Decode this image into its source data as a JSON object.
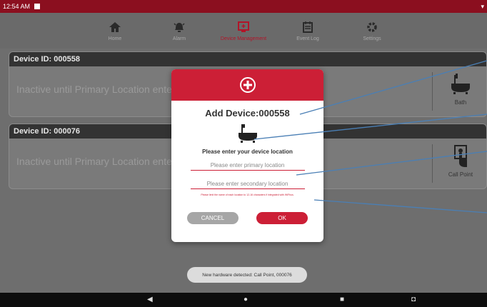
{
  "status_bar": {
    "time": "12:54 AM"
  },
  "nav": {
    "items": [
      {
        "label": "Home",
        "icon": "home-icon"
      },
      {
        "label": "Alarm",
        "icon": "alarm-icon"
      },
      {
        "label": "Device Management",
        "icon": "device-management-icon"
      },
      {
        "label": "Event Log",
        "icon": "event-log-icon"
      },
      {
        "label": "Settings",
        "icon": "settings-icon"
      }
    ],
    "active": "Device Management"
  },
  "devices": [
    {
      "header": "Device ID: 000558",
      "message": "Inactive until Primary Location entered",
      "type_label": "Bath",
      "icon": "bathtub-icon"
    },
    {
      "header": "Device ID: 000076",
      "message": "Inactive until Primary Location entered",
      "type_label": "Call Point",
      "icon": "call-point-icon"
    }
  ],
  "dialog": {
    "title": "Add Device:000558",
    "prompt": "Please enter your device location",
    "primary_placeholder": "Please enter primary location",
    "secondary_placeholder": "Please enter secondary location",
    "note": "Please limit the name of each location to 12-16 characters if integrated with WiFbus.",
    "cancel_label": "CANCEL",
    "ok_label": "OK"
  },
  "toast": "New hardware detected: Call Point, 000076",
  "colors": {
    "accent": "#cc1f36",
    "status_bar": "#8b0f1f"
  }
}
